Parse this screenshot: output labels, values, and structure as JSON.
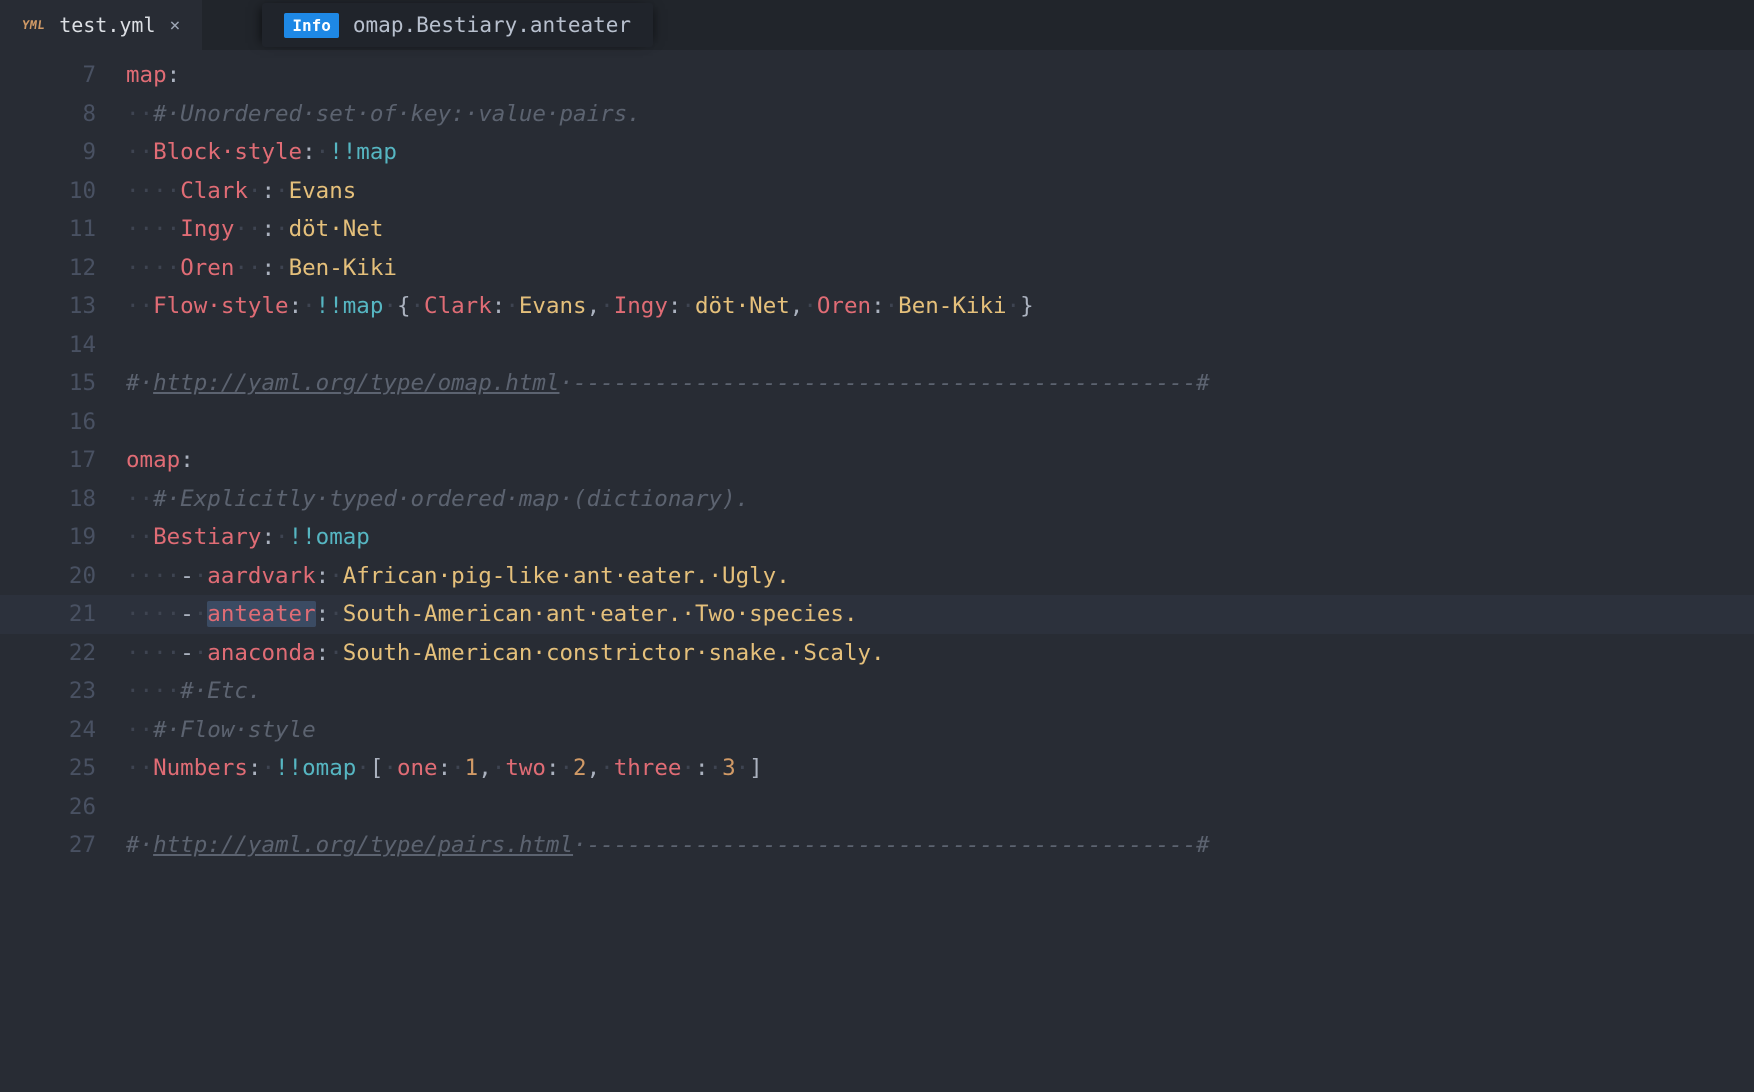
{
  "tab": {
    "filename": "test.yml",
    "icon_label": "YML"
  },
  "crumb": {
    "badge": "Info",
    "path": "omap.Bestiary.anteater"
  },
  "gutter_start": 7,
  "highlight_line_index": 14,
  "lines": [
    [
      {
        "t": "k",
        "v": "map"
      },
      {
        "t": "p",
        "v": ":"
      }
    ],
    [
      {
        "t": "ws",
        "v": "··"
      },
      {
        "t": "c",
        "v": "#·Unordered·set·of·key:·value·pairs."
      }
    ],
    [
      {
        "t": "ws",
        "v": "··"
      },
      {
        "t": "ks",
        "v": "Block·style"
      },
      {
        "t": "p",
        "v": ":"
      },
      {
        "t": "ws",
        "v": "·"
      },
      {
        "t": "tag",
        "v": "!!map"
      }
    ],
    [
      {
        "t": "ws",
        "v": "····"
      },
      {
        "t": "ks",
        "v": "Clark"
      },
      {
        "t": "ws",
        "v": "·"
      },
      {
        "t": "p",
        "v": ":"
      },
      {
        "t": "ws",
        "v": "·"
      },
      {
        "t": "s",
        "v": "Evans"
      }
    ],
    [
      {
        "t": "ws",
        "v": "····"
      },
      {
        "t": "ks",
        "v": "Ingy"
      },
      {
        "t": "ws",
        "v": "··"
      },
      {
        "t": "p",
        "v": ":"
      },
      {
        "t": "ws",
        "v": "·"
      },
      {
        "t": "s",
        "v": "döt·Net"
      }
    ],
    [
      {
        "t": "ws",
        "v": "····"
      },
      {
        "t": "ks",
        "v": "Oren"
      },
      {
        "t": "ws",
        "v": "··"
      },
      {
        "t": "p",
        "v": ":"
      },
      {
        "t": "ws",
        "v": "·"
      },
      {
        "t": "s",
        "v": "Ben-Kiki"
      }
    ],
    [
      {
        "t": "ws",
        "v": "··"
      },
      {
        "t": "ks",
        "v": "Flow·style"
      },
      {
        "t": "p",
        "v": ":"
      },
      {
        "t": "ws",
        "v": "·"
      },
      {
        "t": "tag",
        "v": "!!map"
      },
      {
        "t": "ws",
        "v": "·"
      },
      {
        "t": "p",
        "v": "{"
      },
      {
        "t": "ws",
        "v": "·"
      },
      {
        "t": "ks",
        "v": "Clark"
      },
      {
        "t": "p",
        "v": ":"
      },
      {
        "t": "ws",
        "v": "·"
      },
      {
        "t": "s",
        "v": "Evans"
      },
      {
        "t": "p",
        "v": ","
      },
      {
        "t": "ws",
        "v": "·"
      },
      {
        "t": "ks",
        "v": "Ingy"
      },
      {
        "t": "p",
        "v": ":"
      },
      {
        "t": "ws",
        "v": "·"
      },
      {
        "t": "s",
        "v": "döt·Net"
      },
      {
        "t": "p",
        "v": ","
      },
      {
        "t": "ws",
        "v": "·"
      },
      {
        "t": "ks",
        "v": "Oren"
      },
      {
        "t": "p",
        "v": ":"
      },
      {
        "t": "ws",
        "v": "·"
      },
      {
        "t": "s",
        "v": "Ben-Kiki"
      },
      {
        "t": "ws",
        "v": "·"
      },
      {
        "t": "p",
        "v": "}"
      }
    ],
    [],
    [
      {
        "t": "c",
        "v": "#·"
      },
      {
        "t": "url",
        "v": "http://yaml.org/type/omap.html"
      },
      {
        "t": "c",
        "v": "·----------------------------------------------#"
      }
    ],
    [],
    [
      {
        "t": "k",
        "v": "omap"
      },
      {
        "t": "p",
        "v": ":"
      }
    ],
    [
      {
        "t": "ws",
        "v": "··"
      },
      {
        "t": "c",
        "v": "#·Explicitly·typed·ordered·map·(dictionary)."
      }
    ],
    [
      {
        "t": "ws",
        "v": "··"
      },
      {
        "t": "ks",
        "v": "Bestiary"
      },
      {
        "t": "p",
        "v": ":"
      },
      {
        "t": "ws",
        "v": "·"
      },
      {
        "t": "tag",
        "v": "!!omap"
      }
    ],
    [
      {
        "t": "ws",
        "v": "····"
      },
      {
        "t": "p",
        "v": "-"
      },
      {
        "t": "ws",
        "v": "·"
      },
      {
        "t": "ks",
        "v": "aardvark"
      },
      {
        "t": "p",
        "v": ":"
      },
      {
        "t": "ws",
        "v": "·"
      },
      {
        "t": "s",
        "v": "African·pig-like·ant·eater.·Ugly."
      }
    ],
    [
      {
        "t": "ws",
        "v": "····"
      },
      {
        "t": "p",
        "v": "-"
      },
      {
        "t": "ws",
        "v": "·"
      },
      {
        "t": "ks",
        "v": "anteater",
        "sel": true
      },
      {
        "t": "p",
        "v": ":"
      },
      {
        "t": "ws",
        "v": "·"
      },
      {
        "t": "s",
        "v": "South-American·ant·eater.·Two·species."
      }
    ],
    [
      {
        "t": "ws",
        "v": "····"
      },
      {
        "t": "p",
        "v": "-"
      },
      {
        "t": "ws",
        "v": "·"
      },
      {
        "t": "ks",
        "v": "anaconda"
      },
      {
        "t": "p",
        "v": ":"
      },
      {
        "t": "ws",
        "v": "·"
      },
      {
        "t": "s",
        "v": "South-American·constrictor·snake.·Scaly."
      }
    ],
    [
      {
        "t": "ws",
        "v": "····"
      },
      {
        "t": "c",
        "v": "#·Etc."
      }
    ],
    [
      {
        "t": "ws",
        "v": "··"
      },
      {
        "t": "c",
        "v": "#·Flow·style"
      }
    ],
    [
      {
        "t": "ws",
        "v": "··"
      },
      {
        "t": "ks",
        "v": "Numbers"
      },
      {
        "t": "p",
        "v": ":"
      },
      {
        "t": "ws",
        "v": "·"
      },
      {
        "t": "tag",
        "v": "!!omap"
      },
      {
        "t": "ws",
        "v": "·"
      },
      {
        "t": "p",
        "v": "["
      },
      {
        "t": "ws",
        "v": "·"
      },
      {
        "t": "ks",
        "v": "one"
      },
      {
        "t": "p",
        "v": ":"
      },
      {
        "t": "ws",
        "v": "·"
      },
      {
        "t": "n",
        "v": "1"
      },
      {
        "t": "p",
        "v": ","
      },
      {
        "t": "ws",
        "v": "·"
      },
      {
        "t": "ks",
        "v": "two"
      },
      {
        "t": "p",
        "v": ":"
      },
      {
        "t": "ws",
        "v": "·"
      },
      {
        "t": "n",
        "v": "2"
      },
      {
        "t": "p",
        "v": ","
      },
      {
        "t": "ws",
        "v": "·"
      },
      {
        "t": "ks",
        "v": "three"
      },
      {
        "t": "ws",
        "v": "·"
      },
      {
        "t": "p",
        "v": ":"
      },
      {
        "t": "ws",
        "v": "·"
      },
      {
        "t": "n",
        "v": "3"
      },
      {
        "t": "ws",
        "v": "·"
      },
      {
        "t": "p",
        "v": "]"
      }
    ],
    [],
    [
      {
        "t": "c",
        "v": "#·"
      },
      {
        "t": "url",
        "v": "http://yaml.org/type/pairs.html"
      },
      {
        "t": "c",
        "v": "·---------------------------------------------#"
      }
    ]
  ]
}
